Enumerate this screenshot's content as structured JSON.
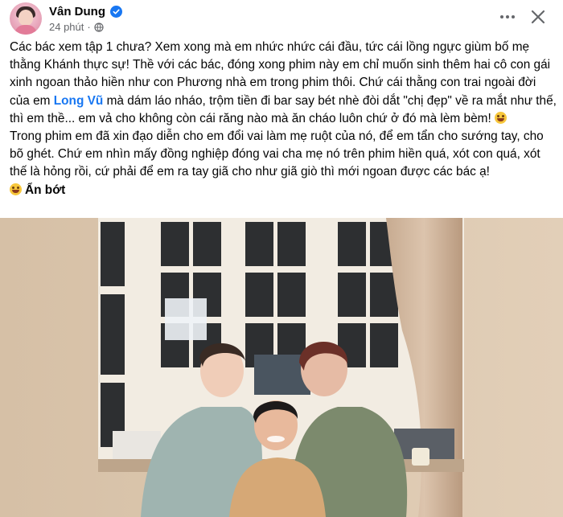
{
  "post": {
    "author_name": "Vân Dung",
    "verified": true,
    "time_ago": "24 phút",
    "audience": "globe-icon",
    "text_part1": "Các bác xem tập 1 chưa? Xem xong mà em nhức nhức cái đầu, tức cái lồng ngực giùm bố mẹ thằng Khánh thực sự! Thề với các bác, đóng xong phim này em chỉ muốn sinh thêm hai cô con gái xinh ngoan thảo hiền như con Phương nhà em trong phim thôi. Chứ cái thằng con trai ngoài đời của em ",
    "mention": "Long Vũ",
    "text_part2": " mà dám láo nháo, trộm tiền đi bar say bét nhè đòi dắt \"chị đẹp\" về ra mắt như thế, thì em thề... em vả cho không còn cái răng nào mà ăn cháo luôn chứ ở đó mà lèm bèm!",
    "text_paragraph2": "Trong phim em đã xin đạo diễn cho em đổi vai làm mẹ ruột của nó, để em tẩn cho sướng tay, cho bõ ghét. Chứ em nhìn mấy đồng nghiệp đóng vai cha mẹ nó trên phim hiền quá, xót con quá, xót thế là hỏng rồi, cứ phải để em ra tay giã cho như giã giò thì mới ngoan được các bác ạ!",
    "see_less": "Ẩn bớt",
    "emoji": "rolling-on-floor-laughing"
  },
  "colors": {
    "mention": "#1877f2",
    "secondary_text": "#65676b",
    "verified": "#1877f2"
  }
}
